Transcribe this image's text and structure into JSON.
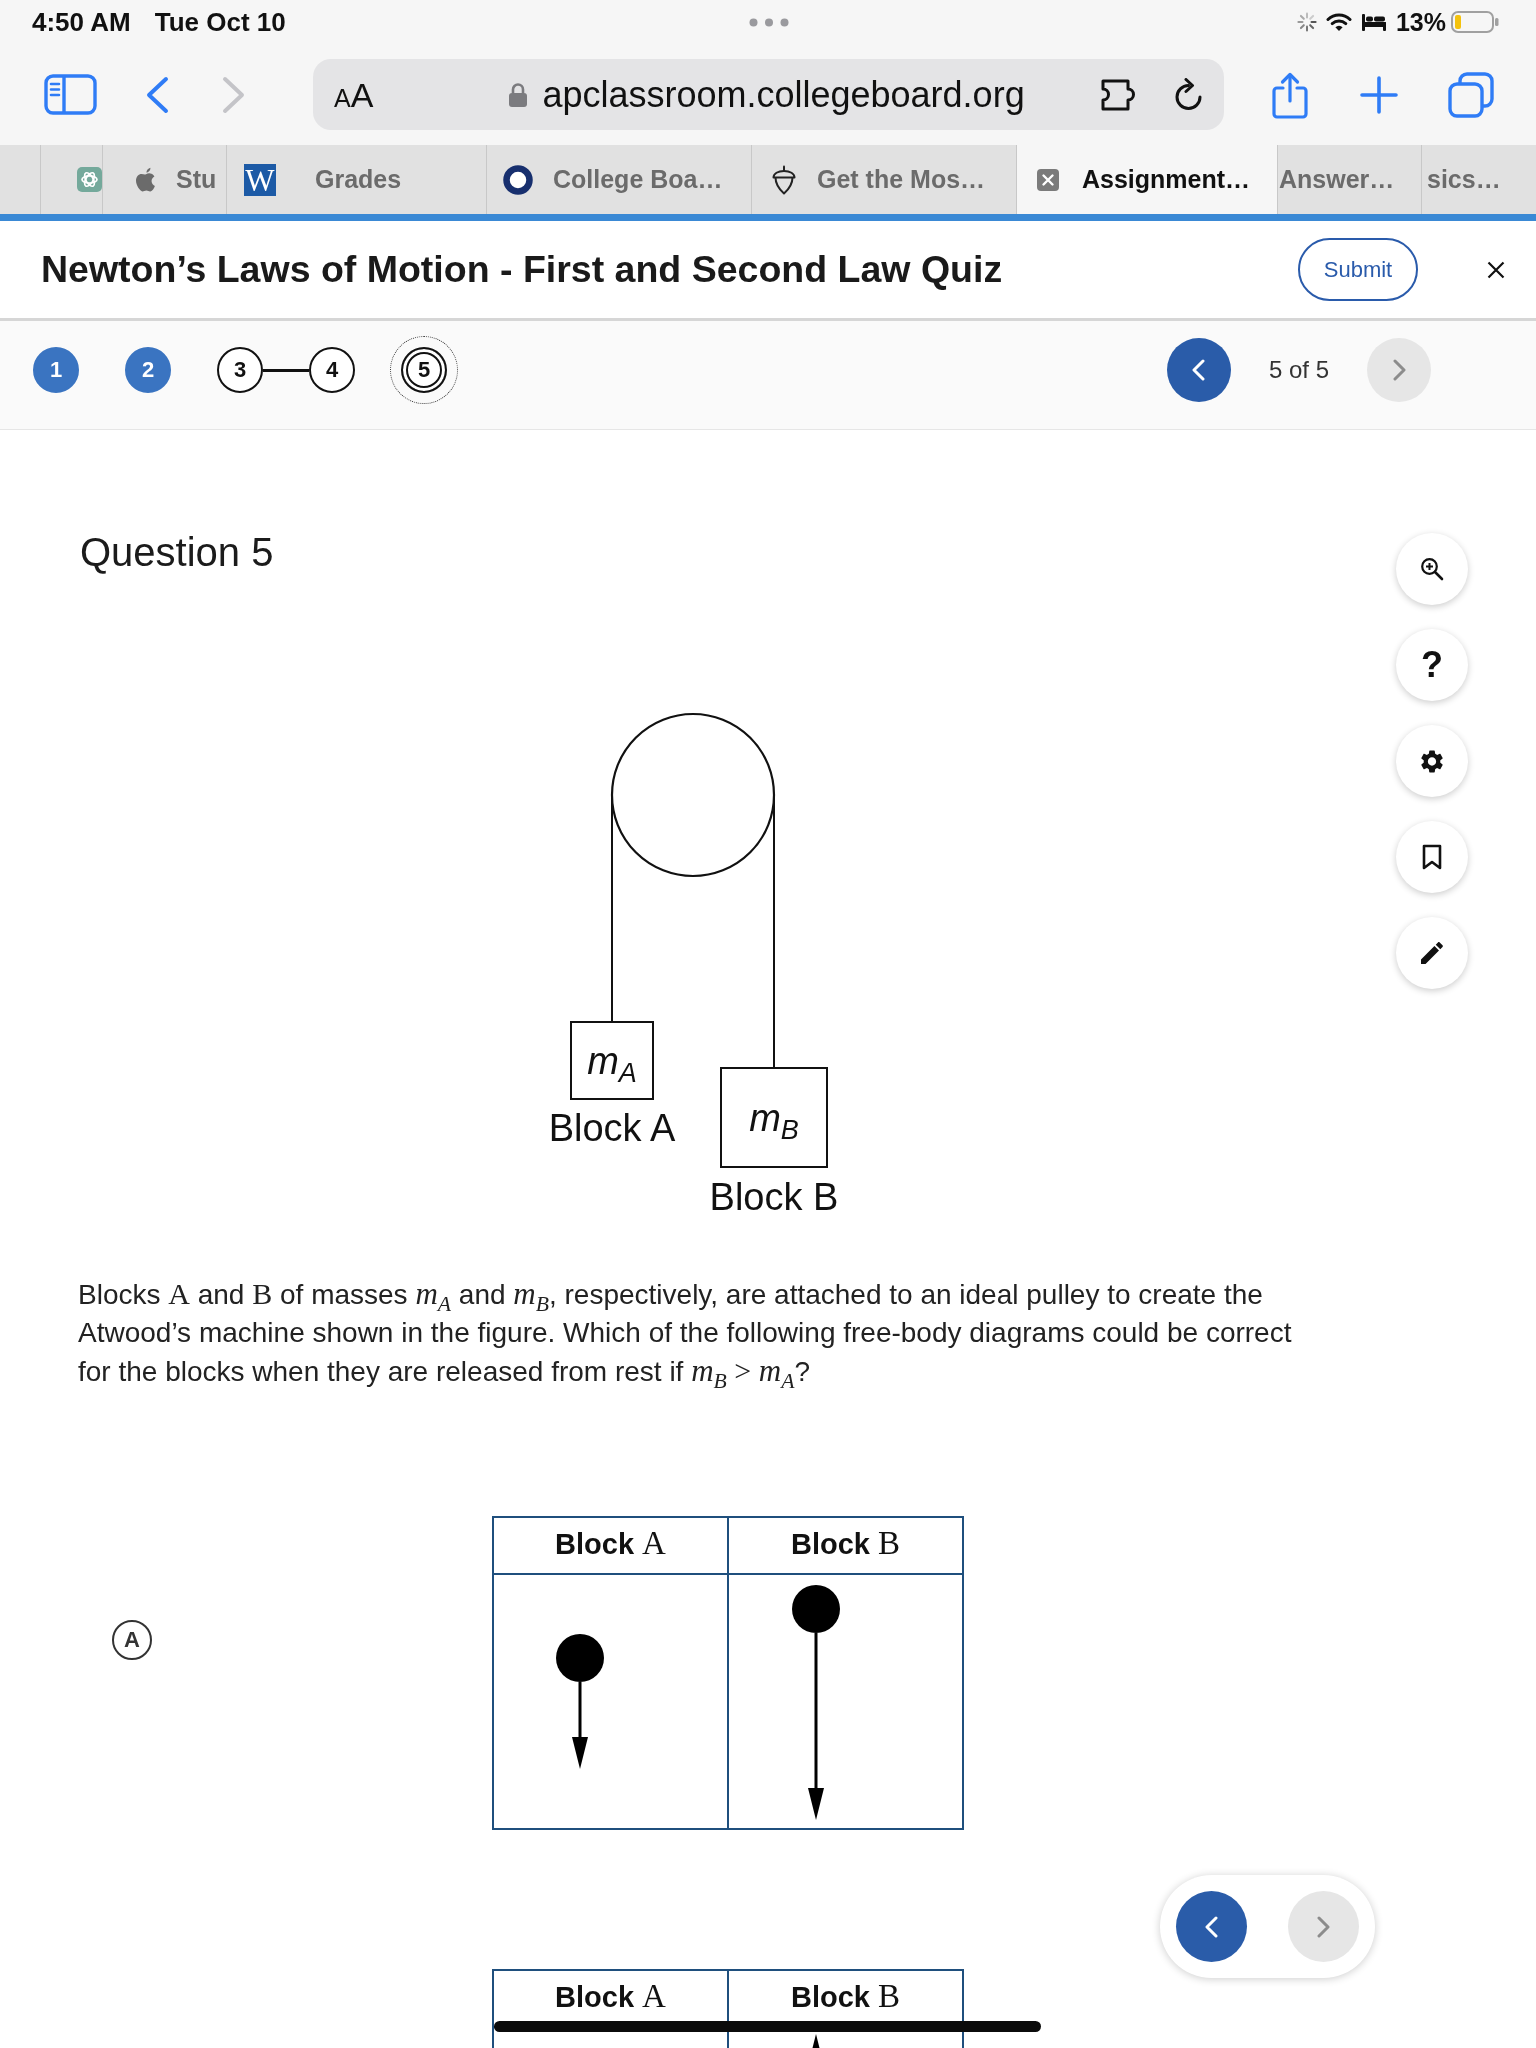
{
  "status_bar": {
    "time": "4:50 AM",
    "date": "Tue Oct 10",
    "battery": "13%"
  },
  "browser": {
    "text_size": "AA",
    "url": "apclassroom.collegeboard.org",
    "tabs": [
      {
        "selected": false
      },
      {
        "label": "Stu",
        "selected": false
      },
      {
        "icon_letter": "W",
        "label": "Grades",
        "selected": false
      },
      {
        "label": "College Boa…",
        "selected": false
      },
      {
        "label": "Get the Mos…",
        "selected": false
      },
      {
        "label": "Assignment…",
        "selected": true
      },
      {
        "label": "Answer…",
        "selected": false
      },
      {
        "label": "sics…",
        "selected": false
      }
    ]
  },
  "quiz_header": {
    "title": "Newton’s Laws of Motion - First and Second Law Quiz",
    "submit": "Submit"
  },
  "navigator": {
    "items": [
      {
        "number": "1",
        "answered": true,
        "selected": false,
        "linked_to_next": false
      },
      {
        "number": "2",
        "answered": true,
        "selected": false,
        "linked_to_next": false
      },
      {
        "number": "3",
        "answered": false,
        "selected": false,
        "linked_to_next": true
      },
      {
        "number": "4",
        "answered": false,
        "selected": false,
        "linked_to_next": false
      },
      {
        "number": "5",
        "answered": false,
        "selected": true,
        "linked_to_next": false
      }
    ],
    "position": "5 of 5",
    "prev_disabled": false,
    "next_disabled": true
  },
  "tools": [
    {
      "kind": "zoom"
    },
    {
      "kind": "help",
      "text": "?"
    },
    {
      "kind": "settings"
    },
    {
      "kind": "bookmark",
      "on": false
    },
    {
      "kind": "annotate"
    }
  ],
  "question": {
    "label": "Question 5",
    "figure": {
      "blocks": [
        {
          "mass": "m$_{A}$",
          "label": "Block A"
        },
        {
          "mass": "m$_{B}$",
          "label": "Block B"
        }
      ]
    },
    "prompt": [
      {
        "kind": "text",
        "text": "Blocks "
      },
      {
        "kind": "symbol",
        "text": "A"
      },
      {
        "kind": "text",
        "text": " and "
      },
      {
        "kind": "symbol",
        "text": "B"
      },
      {
        "kind": "text",
        "text": " of masses "
      },
      {
        "kind": "variable",
        "text": "m$_{A}$"
      },
      {
        "kind": "text",
        "text": " and "
      },
      {
        "kind": "variable",
        "text": "m$_{B}$"
      },
      {
        "kind": "text",
        "text": ", respectively, are attached to an ideal pulley to create the Atwood’s machine shown in the figure. Which of the following free-body diagrams could be correct for the blocks when they are released from rest if "
      },
      {
        "kind": "variable",
        "text": "m$_{B}$"
      },
      {
        "kind": "symbol",
        "text": " > "
      },
      {
        "kind": "variable",
        "text": "m$_{A}$"
      },
      {
        "kind": "text",
        "text": "?"
      }
    ],
    "options": [
      {
        "letter": "A",
        "selected": false,
        "columns": [
          [
            {
              "kind": "text",
              "text": "Block "
            },
            {
              "kind": "symbol",
              "text": "A"
            }
          ],
          [
            {
              "kind": "text",
              "text": "Block "
            },
            {
              "kind": "symbol",
              "text": "B"
            }
          ]
        ]
      },
      {
        "columns": [
          [
            {
              "kind": "text",
              "text": "Block "
            },
            {
              "kind": "symbol",
              "text": "A"
            }
          ],
          [
            {
              "kind": "text",
              "text": "Block "
            },
            {
              "kind": "symbol",
              "text": "B"
            }
          ]
        ]
      }
    ]
  },
  "floating_pager": {
    "prev_disabled": false,
    "next_disabled": true
  }
}
